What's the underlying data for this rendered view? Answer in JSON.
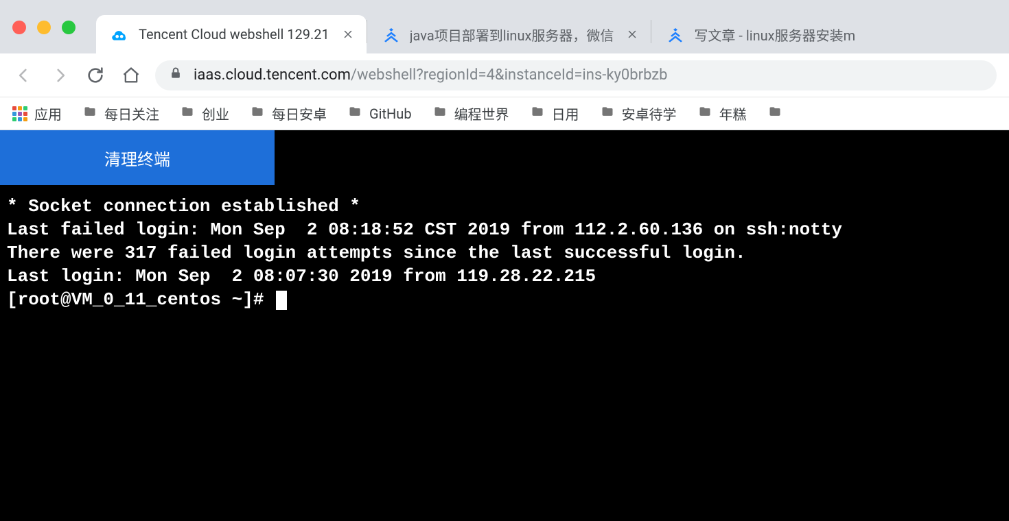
{
  "browser": {
    "tabs": [
      {
        "title": "Tencent Cloud webshell 129.21",
        "active": true,
        "icon": "tencent-cloud"
      },
      {
        "title": "java项目部署到linux服务器，微信",
        "active": false,
        "icon": "juejin"
      },
      {
        "title": "写文章 - linux服务器安装m",
        "active": false,
        "icon": "juejin"
      }
    ],
    "url": {
      "host": "iaas.cloud.tencent.com",
      "path": "/webshell?regionId=4&instanceId=ins-ky0brbzb"
    },
    "bookmarks": {
      "apps_label": "应用",
      "folders": [
        "每日关注",
        "创业",
        "每日安卓",
        "GitHub",
        "编程世界",
        "日用",
        "安卓待学",
        "年糕"
      ]
    }
  },
  "app": {
    "clear_terminal_label": "清理终端"
  },
  "terminal": {
    "lines": [
      "* Socket connection established *",
      "Last failed login: Mon Sep  2 08:18:52 CST 2019 from 112.2.60.136 on ssh:notty",
      "There were 317 failed login attempts since the last successful login.",
      "Last login: Mon Sep  2 08:07:30 2019 from 119.28.22.215"
    ],
    "prompt": "[root@VM_0_11_centos ~]#"
  },
  "colors": {
    "accent_blue": "#1e6fd9",
    "chrome_bg": "#dee1e6"
  }
}
